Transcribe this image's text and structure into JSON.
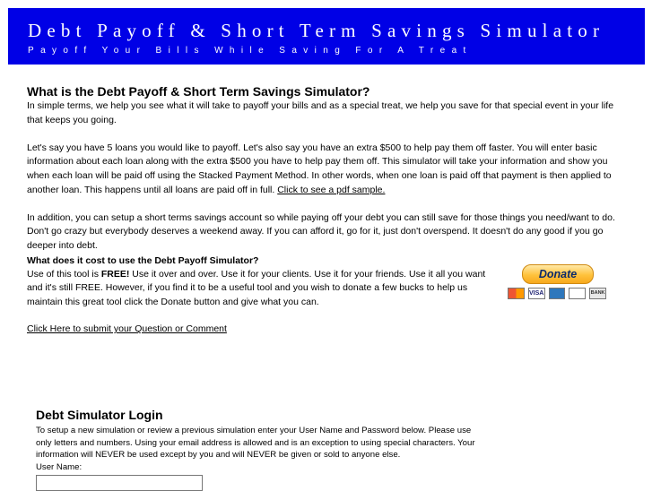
{
  "header": {
    "title": "Debt Payoff & Short Term Savings Simulator",
    "subtitle": "Payoff Your Bills While Saving For A Treat",
    "background_color": "#0000e6"
  },
  "intro": {
    "heading": "What is the Debt Payoff & Short Term Savings Simulator?",
    "para1": "In simple terms, we help you see what it will take to payoff your bills and as a special treat, we help you save for that special event in your life that keeps you going.",
    "para2": "Let's say you have 5 loans you would like to payoff. Let's also say you have an extra $500 to help pay them off faster. You will enter basic information about each loan along with the extra $500 you have to help pay them off.  This simulator will take your information and show you when each loan will be paid off using the Stacked Payment Method.  In other words, when one loan is paid off that payment is then applied to another loan. This happens until all loans are paid off in full. ",
    "pdf_link": "Click to see a pdf sample.",
    "para3": "In addition, you can setup a short terms savings account so while paying off your debt you can still save for those things you need/want to do.  Don't go crazy but everybody deserves a weekend away.  If you can afford it, go for it, just don't overspend.  It doesn't do any good if you go deeper into debt."
  },
  "cost": {
    "heading": "What does it cost to use the Debt Payoff Simulator?",
    "text_before": "Use of this tool is ",
    "free_bold": "FREE!",
    "text_after": "  Use it over and over. Use it for your clients.  Use it for your friends.  Use it all you want and it's still FREE.  However, if you find it to be a useful tool and you wish to donate a few bucks to help us maintain this great tool click the Donate button and give what you can."
  },
  "donate": {
    "button_label": "Donate",
    "cards": [
      "mastercard-icon",
      "visa-icon",
      "amex-icon",
      "discover-icon",
      "bank-icon"
    ],
    "visa_text": "VISA",
    "bank_text": "BANK"
  },
  "comment_link": "Click Here to submit your Question or Comment",
  "login": {
    "heading": "Debt Simulator Login",
    "text": "To setup a new simulation or review a previous simulation enter your User Name and Password below. Please use only letters and numbers. Using your email address is allowed and is an exception to using special characters. Your information will NEVER be used except by you and will NEVER be given or sold to anyone else.",
    "username_label": "User Name:",
    "username_value": ""
  }
}
